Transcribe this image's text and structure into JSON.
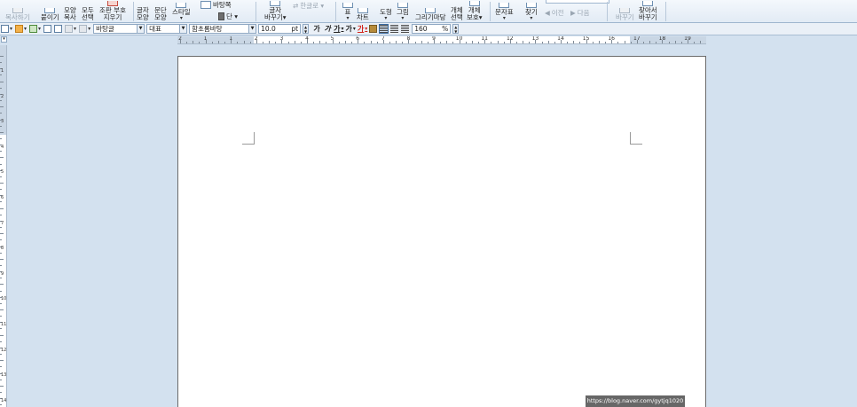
{
  "ribbon": {
    "buttons": [
      {
        "label": "복사하기",
        "label2": "",
        "disabled": true
      },
      {
        "label": "붙이기",
        "label2": ""
      },
      {
        "label": "모양",
        "label2": "복사"
      },
      {
        "label": "모두",
        "label2": "선택"
      },
      {
        "label": "조판 부호",
        "label2": "지우기"
      },
      {
        "label": "글자",
        "label2": "모양"
      },
      {
        "label": "문단",
        "label2": "모양"
      },
      {
        "label": "스타일",
        "label2": "▾"
      },
      {
        "label": "글자",
        "label2": "바꾸기▾"
      },
      {
        "label": "표",
        "label2": "▾"
      },
      {
        "label": "차트",
        "label2": ""
      },
      {
        "label": "도형",
        "label2": "▾"
      },
      {
        "label": "그림",
        "label2": "▾"
      },
      {
        "label": "그리기마당",
        "label2": ""
      },
      {
        "label": "개체",
        "label2": "선택"
      },
      {
        "label": "개체",
        "label2": "보호▾"
      },
      {
        "label": "문자표",
        "label2": "▾"
      },
      {
        "label": "찾기",
        "label2": "▾"
      },
      {
        "label": "바꾸기",
        "label2": "",
        "disabled": true
      },
      {
        "label": "찾아서",
        "label2": "바꾸기"
      }
    ],
    "background_label": "바탕쪽",
    "columns_label": "단 ▾",
    "hangul_convert_label": "한글로 ▾",
    "prev_label": "이전",
    "next_label": "다음"
  },
  "format_toolbar": {
    "style_value": "바탕글",
    "outline_value": "대표",
    "font_value": "함초롬바탕",
    "size_value": "10.0",
    "size_unit": "pt",
    "bold_label": "가",
    "italic_label": "가",
    "underline_label": "가",
    "strike_label": "가",
    "color_label": "가",
    "line_spacing_value": "160",
    "line_spacing_unit": "%"
  },
  "ruler": {
    "numbers": [
      "2",
      "1",
      "1",
      "2",
      "3",
      "4",
      "5",
      "6",
      "7",
      "8",
      "9",
      "10",
      "11",
      "12",
      "13",
      "14",
      "15",
      "16",
      "17",
      "18",
      "19"
    ],
    "vnumbers": [
      "1",
      "2",
      "3",
      "4",
      "5",
      "6",
      "7",
      "8",
      "9",
      "10",
      "11",
      "12",
      "13",
      "14"
    ]
  },
  "watermark": "https://blog.naver.com/gytjq1020",
  "colors": {
    "workspace_bg": "#d3e1ef",
    "ribbon_bg": "#e2ebf5",
    "page_bg": "#ffffff"
  }
}
